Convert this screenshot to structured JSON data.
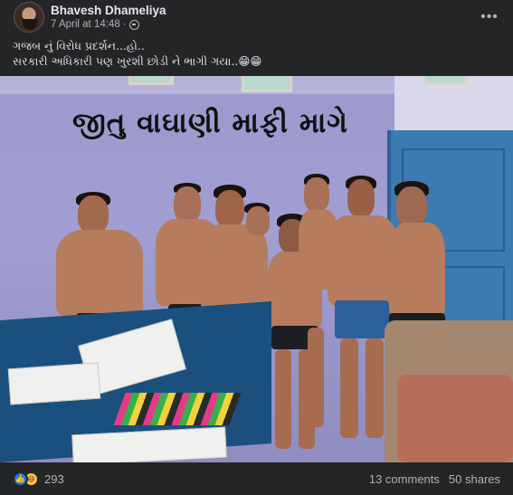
{
  "post": {
    "author": "Bhavesh Dhameliya",
    "timestamp": "7 April at 14:48",
    "separator": "·",
    "privacy_icon": "globe-icon",
    "more_label": "•••",
    "caption_lines": [
      "ગજબ નું વિરોધ પ્રદર્શન...હો..",
      "સરકારી અધિકારી પણ ખુરશી છોડી ને ભાગી ગયા..😁😁"
    ]
  },
  "photo": {
    "wall_text": "જીતુ વાઘાણી માફી માગે"
  },
  "footer": {
    "reaction_icons": [
      "like-icon",
      "haha-icon"
    ],
    "reaction_count": "293",
    "comments": "13 comments",
    "shares": "50 shares"
  },
  "colors": {
    "background": "#242526",
    "text_primary": "#e4e6eb",
    "text_secondary": "#b0b3b8",
    "like_blue": "#1877f2"
  }
}
